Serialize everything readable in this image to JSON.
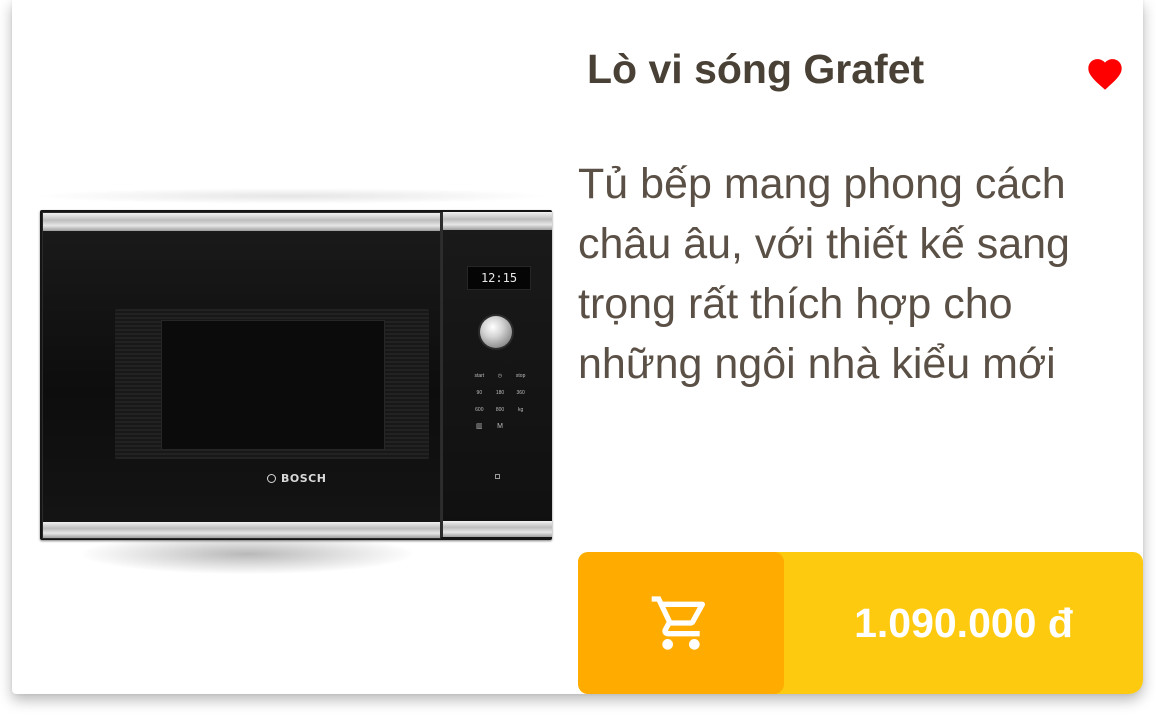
{
  "product": {
    "title": "Lò vi sóng Grafet",
    "description": "Tủ bếp mang phong cách châu âu, với thiết kế sang trọng rất thích hợp cho những ngôi nhà kiểu mới",
    "price": "1.090.000 đ",
    "favorited": true
  },
  "image": {
    "brand": "BOSCH",
    "display_time": "12:15",
    "keys": [
      "start",
      "◷",
      "stop",
      "90",
      "180",
      "360",
      "600",
      "800",
      "kg",
      "▥",
      "M",
      ""
    ]
  },
  "icons": {
    "favorite": "heart-icon",
    "cart": "shopping-cart-icon"
  },
  "colors": {
    "title_text": "#4a4136",
    "body_text": "#5b5046",
    "heart": "#ff0000",
    "cart_button": "#ffab00",
    "price_bar": "#fdca0f",
    "price_text": "#ffffff"
  }
}
